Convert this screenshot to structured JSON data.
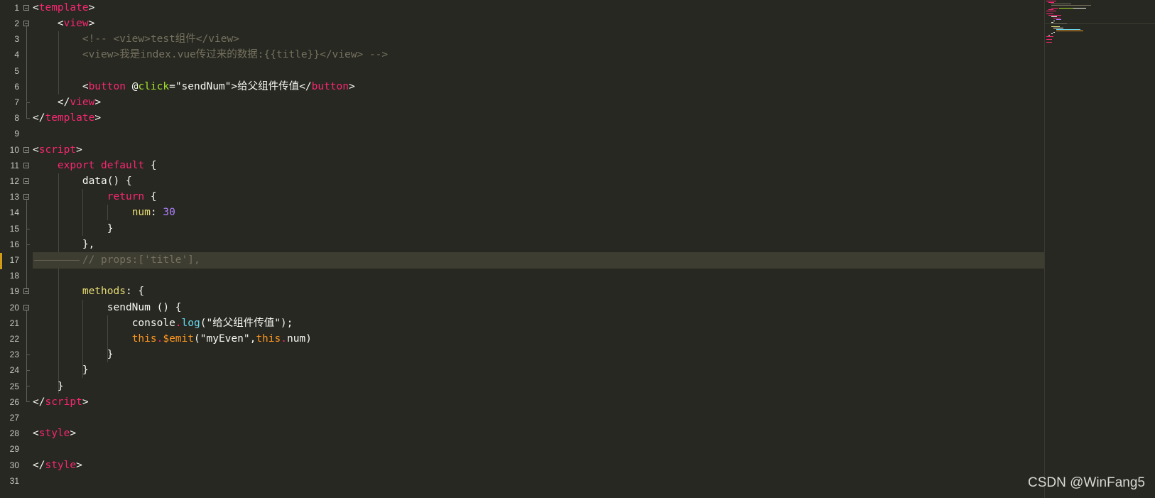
{
  "editor": {
    "line_numbers": [
      "1",
      "2",
      "3",
      "4",
      "5",
      "6",
      "7",
      "8",
      "9",
      "10",
      "11",
      "12",
      "13",
      "14",
      "15",
      "16",
      "17",
      "18",
      "19",
      "20",
      "21",
      "22",
      "23",
      "24",
      "25",
      "26",
      "27",
      "28",
      "29",
      "30",
      "31"
    ],
    "active_line": "17",
    "colors": {
      "background": "#272822",
      "tag": "#f92672",
      "attribute": "#a6e22e",
      "comment": "#75715e",
      "number": "#ae81ff",
      "property": "#e6db74",
      "builtin": "#66d9ef",
      "this": "#fd971f",
      "text": "#f8f8f2",
      "active_line_bg": "#3e3d32",
      "modified_marker": "#d19a17"
    },
    "code": {
      "l1": {
        "open": "<",
        "tag": "template",
        "close": ">"
      },
      "l2": {
        "indent": "    ",
        "open": "<",
        "tag": "view",
        "close": ">"
      },
      "l3": {
        "indent": "        ",
        "text": "<!-- <view>test组件</view>"
      },
      "l4": {
        "indent": "        ",
        "text": "<view>我是index.vue传过来的数据:{{title}}</view> -->"
      },
      "l6": {
        "indent": "        ",
        "open": "<",
        "tag": "button",
        "space": " ",
        "at": "@",
        "attr": "click",
        "eq": "=",
        "value": "\"sendNum\"",
        "gt": ">",
        "text": "给父组件传值",
        "close_open": "</",
        "close_tag": "button",
        "close_gt": ">"
      },
      "l7": {
        "indent": "    ",
        "open": "</",
        "tag": "view",
        "close": ">"
      },
      "l8": {
        "open": "</",
        "tag": "template",
        "close": ">"
      },
      "l10": {
        "open": "<",
        "tag": "script",
        "close": ">"
      },
      "l11": {
        "indent": "    ",
        "kw1": "export",
        "space": " ",
        "kw2": "default",
        "rest": " {"
      },
      "l12": {
        "indent": "        ",
        "text": "data() {"
      },
      "l13": {
        "indent": "            ",
        "kw": "return",
        "rest": " {"
      },
      "l14": {
        "indent": "                ",
        "prop": "num",
        "colon": ": ",
        "num": "30"
      },
      "l15": {
        "indent": "            ",
        "text": "}"
      },
      "l16": {
        "indent": "        ",
        "text": "},"
      },
      "l17": {
        "indent": "        ",
        "text": "// props:['title'],"
      },
      "l19": {
        "indent": "        ",
        "prop": "methods",
        "rest": ": {"
      },
      "l20": {
        "indent": "            ",
        "text": "sendNum () {"
      },
      "l21": {
        "indent": "                ",
        "obj": "console",
        "dot": ".",
        "method": "log",
        "rest": "(\"给父组件传值\");"
      },
      "l22": {
        "indent": "                ",
        "this1": "this",
        "dot1": ".",
        "emit": "$emit",
        "mid": "(\"myEven\",",
        "this2": "this",
        "dot2": ".",
        "end": "num)"
      },
      "l23": {
        "indent": "            ",
        "text": "}"
      },
      "l24": {
        "indent": "        ",
        "text": "}"
      },
      "l25": {
        "indent": "    ",
        "text": "}"
      },
      "l26": {
        "open": "</",
        "tag": "script",
        "close": ">"
      },
      "l28": {
        "open": "<",
        "tag": "style",
        "close": ">"
      },
      "l30": {
        "open": "</",
        "tag": "style",
        "close": ">"
      }
    }
  },
  "watermark": "CSDN @WinFang5"
}
